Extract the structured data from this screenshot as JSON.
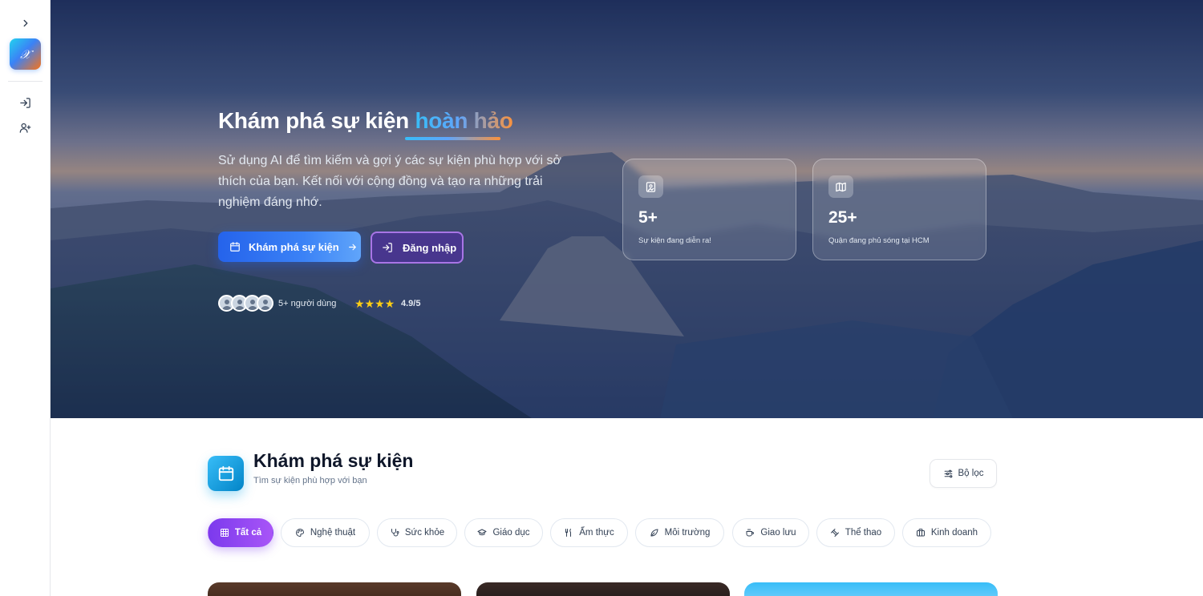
{
  "sidebar": {
    "toggle_icon": "chevron-right-icon",
    "logo_text": "𝒳",
    "items": [
      {
        "icon": "login-icon"
      },
      {
        "icon": "user-plus-icon"
      }
    ]
  },
  "hero": {
    "title_main": "Khám phá sự kiện ",
    "title_accent": "hoàn hảo",
    "description": "Sử dụng AI để tìm kiếm và gợi ý các sự kiện phù hợp với sở thích của bạn. Kết nối với cộng đồng và tạo ra những trải nghiệm đáng nhớ.",
    "primary_button": "Khám phá sự kiện",
    "secondary_button": "Đăng nhập",
    "users_text": "5+ người dùng",
    "stars": "★★★★",
    "rating": "4.9/5",
    "stats": [
      {
        "icon": "image-icon",
        "value": "5+",
        "label": "Sự kiện đang diễn ra!"
      },
      {
        "icon": "map-icon",
        "value": "25+",
        "label": "Quận đang phủ sóng tại HCM"
      }
    ]
  },
  "section": {
    "title": "Khám phá sự kiện",
    "subtitle": "Tìm sự kiện phù hợp với bạn",
    "filter_button": "Bộ lọc",
    "categories": [
      {
        "label": "Tất cả",
        "icon": "grid-icon",
        "active": true
      },
      {
        "label": "Nghệ thuật",
        "icon": "palette-icon",
        "active": false
      },
      {
        "label": "Sức khỏe",
        "icon": "stethoscope-icon",
        "active": false
      },
      {
        "label": "Giáo dục",
        "icon": "graduation-cap-icon",
        "active": false
      },
      {
        "label": "Ẩm thực",
        "icon": "utensils-icon",
        "active": false
      },
      {
        "label": "Môi trường",
        "icon": "leaf-icon",
        "active": false
      },
      {
        "label": "Giao lưu",
        "icon": "coffee-icon",
        "active": false
      },
      {
        "label": "Thể thao",
        "icon": "dumbbell-icon",
        "active": false
      },
      {
        "label": "Kinh doanh",
        "icon": "briefcase-icon",
        "active": false
      }
    ]
  },
  "colors": {
    "accent_blue": "#2563eb",
    "accent_purple": "#7c3aed",
    "section_icon": "#0ea5e9"
  }
}
